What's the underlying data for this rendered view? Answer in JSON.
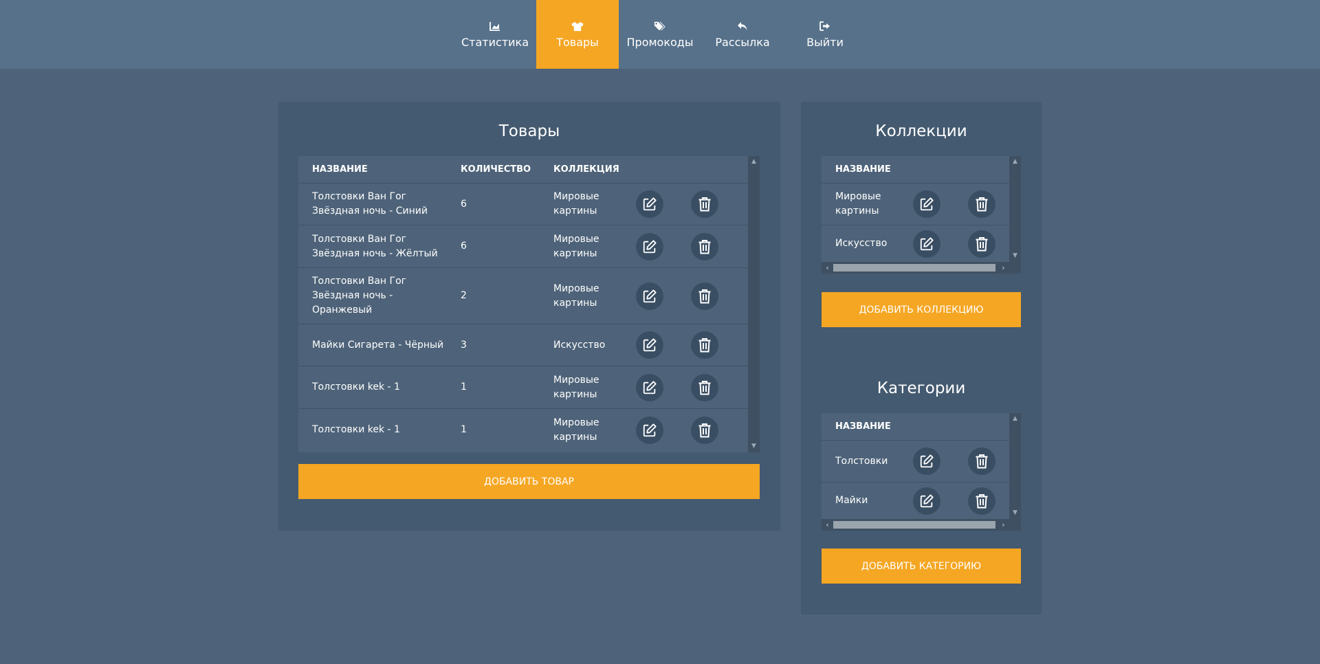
{
  "nav": {
    "items": [
      {
        "label": "Статистика",
        "icon": "chart-icon",
        "active": false
      },
      {
        "label": "Товары",
        "icon": "tshirt-icon",
        "active": true
      },
      {
        "label": "Промокоды",
        "icon": "tags-icon",
        "active": false
      },
      {
        "label": "Рассылка",
        "icon": "reply-icon",
        "active": false
      },
      {
        "label": "Выйти",
        "icon": "sign-out-icon",
        "active": false
      }
    ]
  },
  "products": {
    "title": "Товары",
    "columns": [
      "Название",
      "Количество",
      "Коллекция"
    ],
    "rows": [
      {
        "name": "Толстовки Ван Гог Звёздная ночь - Синий",
        "qty": "6",
        "collection": "Мировые картины"
      },
      {
        "name": "Толстовки Ван Гог Звёздная ночь - Жёлтый",
        "qty": "6",
        "collection": "Мировые картины"
      },
      {
        "name": "Толстовки Ван Гог Звёздная ночь - Оранжевый",
        "qty": "2",
        "collection": "Мировые картины"
      },
      {
        "name": "Майки Сигарета - Чёрный",
        "qty": "3",
        "collection": "Искусство"
      },
      {
        "name": "Толстовки kek - 1",
        "qty": "1",
        "collection": "Мировые картины"
      },
      {
        "name": "Толстовки kek - 1",
        "qty": "1",
        "collection": "Мировые картины"
      }
    ],
    "add_label": "Добавить товар"
  },
  "collections": {
    "title": "Коллекции",
    "column": "Название",
    "rows": [
      {
        "name": "Мировые картины"
      },
      {
        "name": "Искусство"
      }
    ],
    "add_label": "Добавить коллекцию"
  },
  "categories": {
    "title": "Категории",
    "column": "Название",
    "rows": [
      {
        "name": "Толстовки"
      },
      {
        "name": "Майки"
      }
    ],
    "add_label": "Добавить категорию"
  },
  "colors": {
    "accent": "#f5a623",
    "background": "#4e6379",
    "topbar": "#57718a",
    "panel": "#445a70",
    "action_circle": "#3a4e63"
  }
}
